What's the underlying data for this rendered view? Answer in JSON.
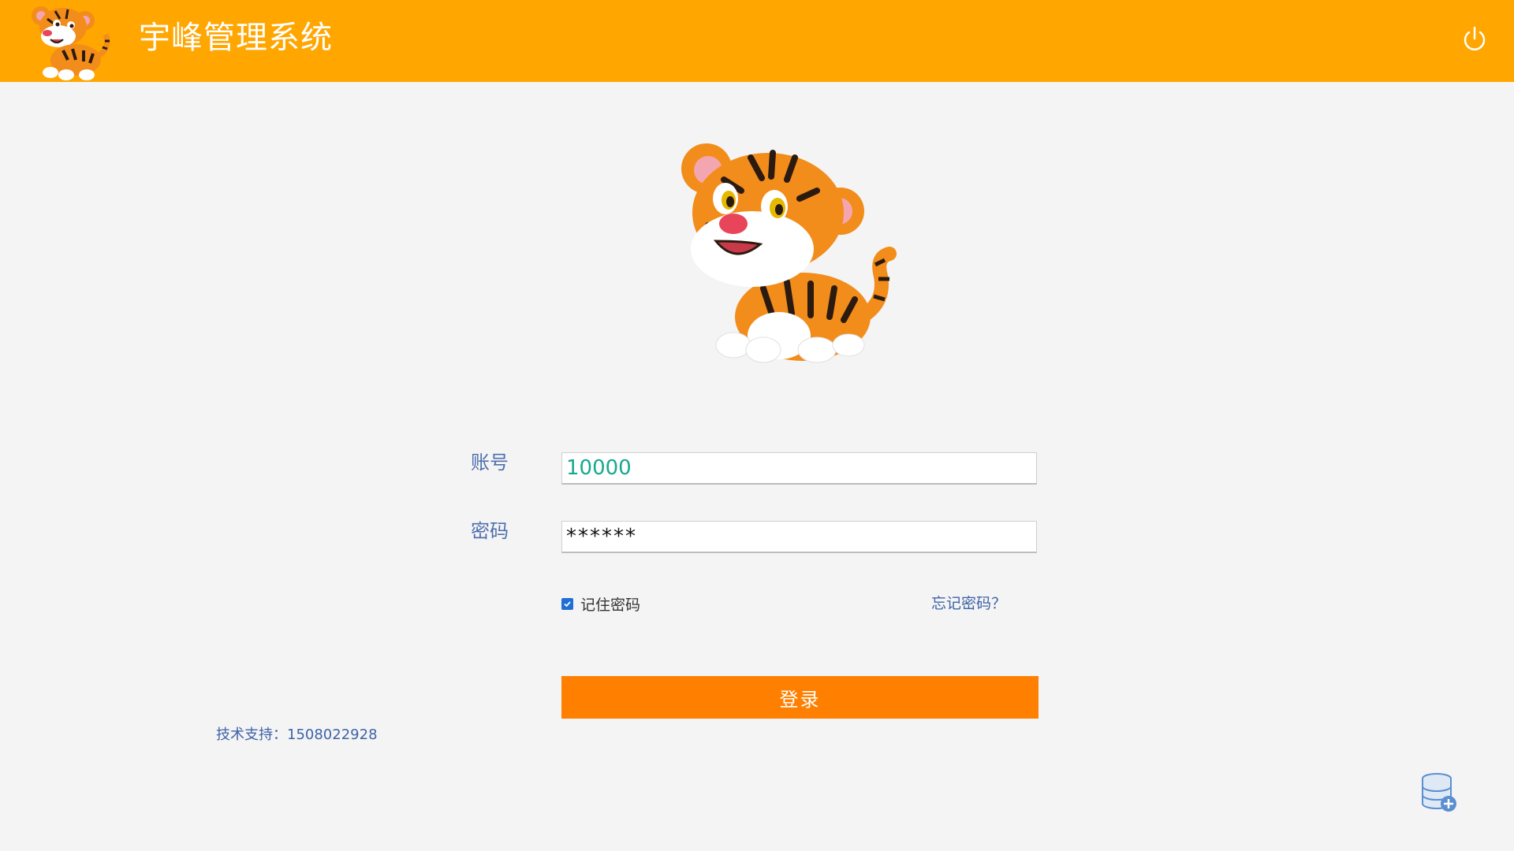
{
  "header": {
    "title": "宇峰管理系统",
    "background_color": "#ffa600",
    "logo_icon": "tiger-logo-icon",
    "power_icon": "power-icon"
  },
  "mascot": {
    "icon": "tiger-mascot-image"
  },
  "form": {
    "account_label": "账号",
    "account_value": "10000",
    "password_label": "密码",
    "password_value": "******",
    "remember_label": "记住密码",
    "remember_checked": true,
    "forgot_link": "忘记密码？",
    "login_button": "登录",
    "login_button_color": "#ff8000"
  },
  "footer": {
    "support_text": "技术支持：1508022928",
    "database_icon": "database-add-icon"
  }
}
